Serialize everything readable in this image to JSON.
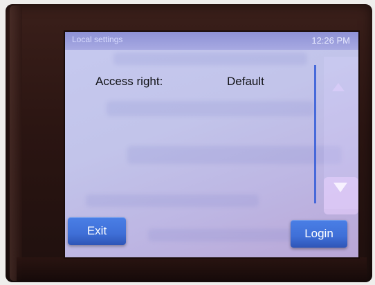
{
  "screen": {
    "title": "Local settings",
    "time": "12:26 PM"
  },
  "access": {
    "label": "Access right:",
    "value": "Default"
  },
  "buttons": {
    "exit_label": "Exit",
    "login_label": "Login"
  },
  "icons": {
    "scroll_up": "chevron-up-icon",
    "scroll_down": "chevron-down-icon"
  },
  "colors": {
    "accent": "#3f6fd7",
    "screen_bg": "#c6c9ef",
    "titlebar": "#a7a9e2"
  }
}
